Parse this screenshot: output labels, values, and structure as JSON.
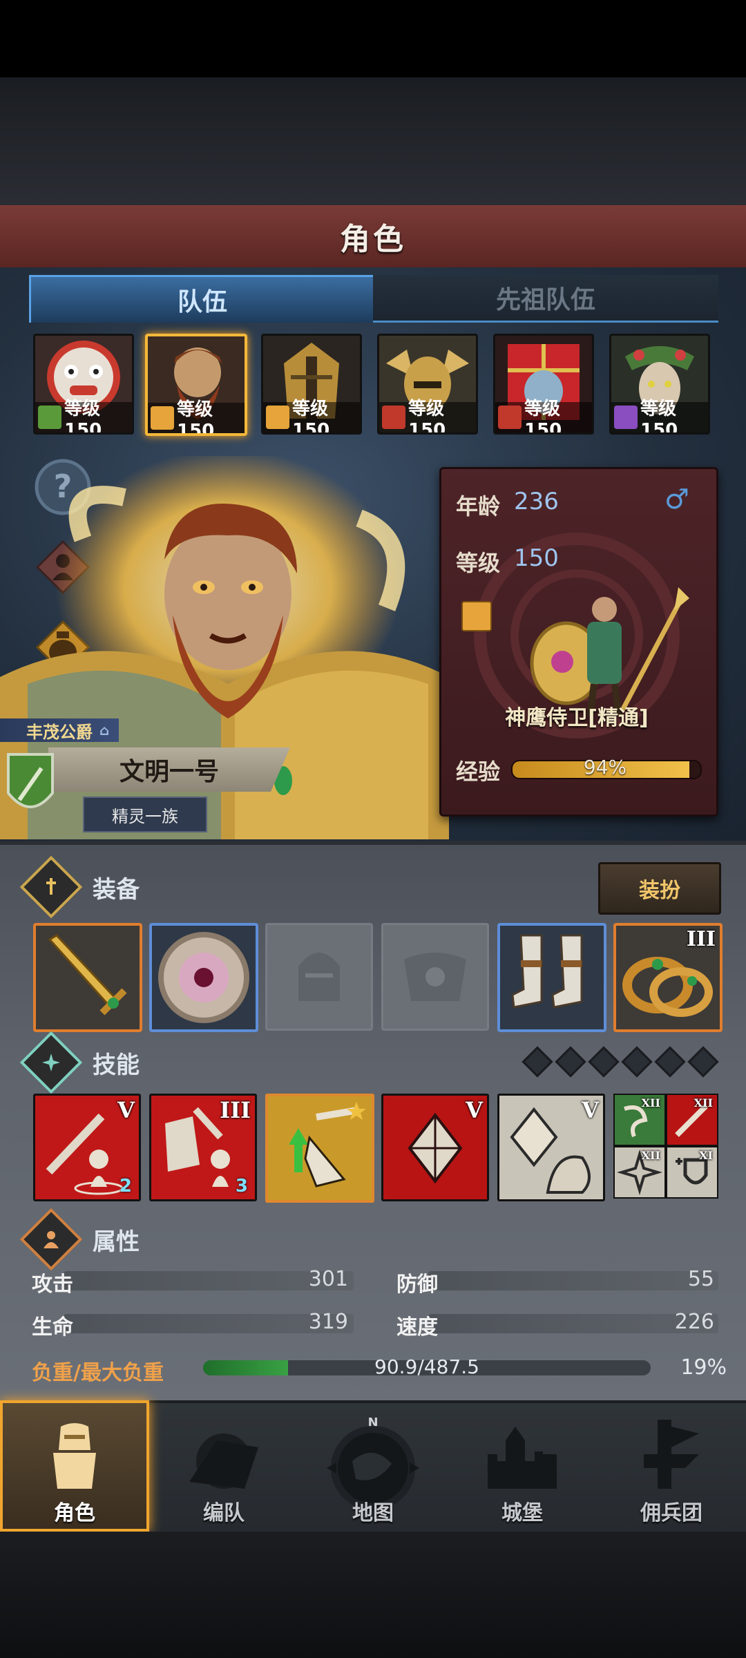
{
  "header": {
    "title": "角色"
  },
  "tabs": [
    {
      "label": "队伍",
      "active": true
    },
    {
      "label": "先祖队伍",
      "active": false
    }
  ],
  "team": [
    {
      "level": "等级150",
      "class_icon": "bow-icon",
      "selected": false
    },
    {
      "level": "等级150",
      "class_icon": "shield-icon",
      "selected": true
    },
    {
      "level": "等级150",
      "class_icon": "shield-icon",
      "selected": false
    },
    {
      "level": "等级150",
      "class_icon": "horse-icon",
      "selected": false
    },
    {
      "level": "等级150",
      "class_icon": "horse-icon",
      "selected": false
    },
    {
      "level": "等级150",
      "class_icon": "staff-icon",
      "selected": false
    }
  ],
  "hero": {
    "title": "丰茂公爵",
    "name": "文明一号",
    "race": "精灵一族"
  },
  "info": {
    "age_label": "年龄",
    "age": "236",
    "level_label": "等级",
    "level": "150",
    "class_name": "神鹰侍卫[精通]",
    "exp_label": "经验",
    "exp_percent": "94%",
    "exp_value": 94
  },
  "equipment": {
    "title": "装备",
    "dress_button": "装扮",
    "slots": [
      {
        "name": "sword",
        "border": "orange"
      },
      {
        "name": "shield",
        "border": "blue"
      },
      {
        "name": "helmet",
        "border": "empty"
      },
      {
        "name": "armor",
        "border": "empty"
      },
      {
        "name": "boots",
        "border": "blue"
      },
      {
        "name": "ring",
        "border": "orange",
        "tier": "III"
      }
    ]
  },
  "skills": {
    "title": "技能",
    "gem_count": 6,
    "items": [
      {
        "tier": "V",
        "badge": "2"
      },
      {
        "tier": "III",
        "badge": "3"
      },
      {
        "tier": "",
        "badge": ""
      },
      {
        "tier": "V",
        "badge": ""
      },
      {
        "tier": "V",
        "badge": ""
      }
    ],
    "mini": [
      "XII",
      "XII",
      "XII",
      "XI"
    ]
  },
  "attributes": {
    "title": "属性",
    "attack_label": "攻击",
    "attack": "301",
    "defense_label": "防御",
    "defense": "55",
    "hp_label": "生命",
    "hp": "319",
    "speed_label": "速度",
    "speed": "226",
    "load_label": "负重/最大负重",
    "load_value": "90.9/487.5",
    "load_percent": "19%",
    "load_fraction": 0.19
  },
  "nav": [
    {
      "label": "角色",
      "active": true
    },
    {
      "label": "编队",
      "active": false
    },
    {
      "label": "地图",
      "active": false,
      "compass": "N"
    },
    {
      "label": "城堡",
      "active": false
    },
    {
      "label": "佣兵团",
      "active": false
    }
  ],
  "colors": {
    "accent_gold": "#f0a52e",
    "tab_active": "#3b6da1",
    "exp_bar": "#f1c14a",
    "load_bar": "#39a144"
  }
}
